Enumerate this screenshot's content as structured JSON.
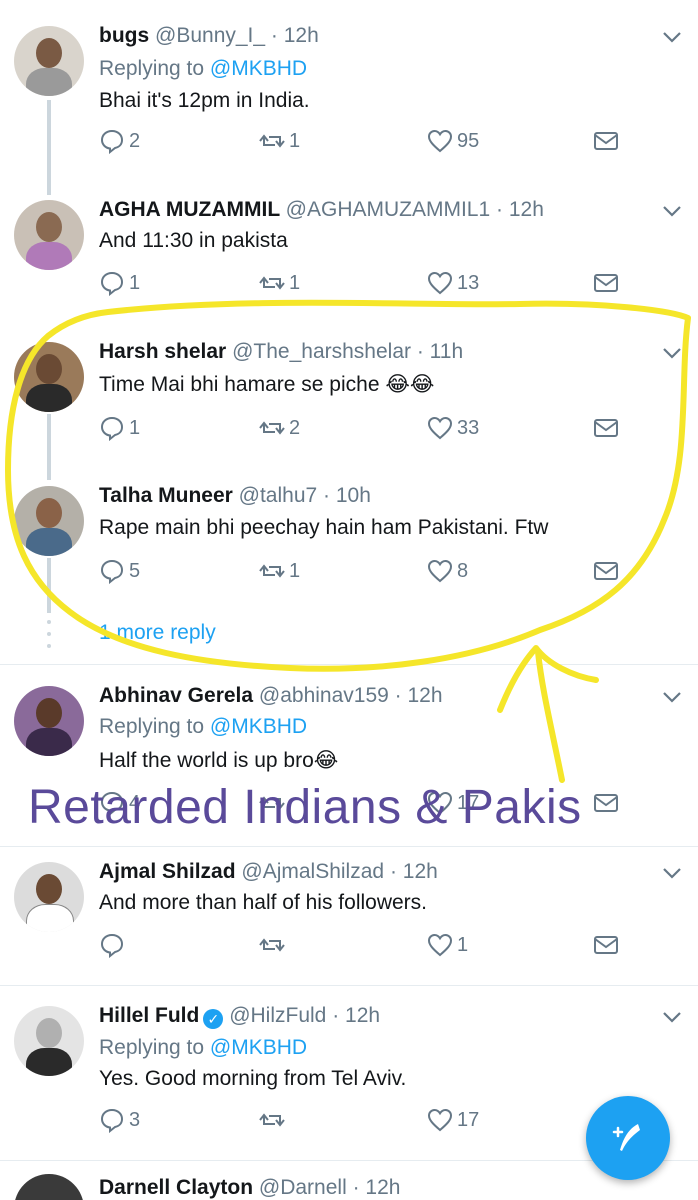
{
  "tweets": [
    {
      "name": "bugs",
      "handle": "@Bunny_I_",
      "time": "· 12h",
      "replying_prefix": "Replying to",
      "replying_handle": "@MKBHD",
      "text": "Bhai it's 12pm in India.",
      "replies": "2",
      "retweets": "1",
      "likes": "95"
    },
    {
      "name": "AGHA MUZAMMIL",
      "handle": "@AGHAMUZAMMIL1",
      "time": "· 12h",
      "text": "And 11:30 in pakista",
      "replies": "1",
      "retweets": "1",
      "likes": "13"
    },
    {
      "name": "Harsh shelar",
      "handle": "@The_harshshelar",
      "time": "· 11h",
      "text": "Time Mai bhi hamare se piche 😂😂",
      "replies": "1",
      "retweets": "2",
      "likes": "33"
    },
    {
      "name": "Talha Muneer",
      "handle": "@talhu7",
      "time": "· 10h",
      "text": "Rape main bhi peechay hain ham Pakistani. Ftw",
      "replies": "5",
      "retweets": "1",
      "likes": "8"
    },
    {
      "name": "Abhinav Gerela",
      "handle": "@abhinav159",
      "time": "· 12h",
      "replying_prefix": "Replying to",
      "replying_handle": "@MKBHD",
      "text": "Half the world is up bro😂",
      "replies": "4",
      "retweets": "",
      "likes": "17"
    },
    {
      "name": "Ajmal Shilzad",
      "handle": "@AjmalShilzad",
      "time": "· 12h",
      "text": "And more than half of his followers.",
      "replies": "",
      "retweets": "",
      "likes": "1"
    },
    {
      "name": "Hillel Fuld",
      "handle": "@HilzFuld",
      "time": "· 12h",
      "replying_prefix": "Replying to",
      "replying_handle": "@MKBHD",
      "text": "Yes. Good morning from Tel Aviv.",
      "replies": "3",
      "retweets": "",
      "likes": "17"
    },
    {
      "name": "Darnell Clayton",
      "handle": "@Darnell",
      "time": "· 12h"
    }
  ],
  "more_reply": "1 more reply",
  "overlay_caption": "Retarded Indians & Pakis",
  "colors": {
    "accent": "#1da1f2",
    "muted": "#657786",
    "annotation": "#f5e62a",
    "caption": "#5a4a9a"
  },
  "icons": {
    "reply": "reply-icon",
    "retweet": "retweet-icon",
    "like": "heart-icon",
    "dm": "envelope-icon",
    "caret": "chevron-down-icon",
    "compose": "compose-feather-icon"
  }
}
